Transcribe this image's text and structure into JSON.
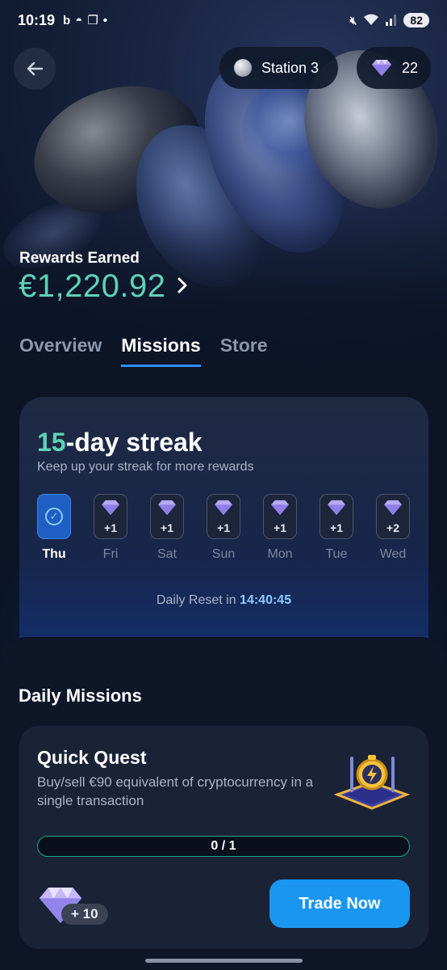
{
  "status_bar": {
    "time": "10:19",
    "battery": "82"
  },
  "header": {
    "station": "Station 3",
    "gems": "22"
  },
  "rewards": {
    "label": "Rewards Earned",
    "amount": "€1,220.92"
  },
  "tabs": [
    {
      "label": "Overview",
      "active": false
    },
    {
      "label": "Missions",
      "active": true
    },
    {
      "label": "Store",
      "active": false
    }
  ],
  "streak": {
    "count": "15",
    "title_suffix": "-day streak",
    "subtitle": "Keep up your streak for more rewards",
    "days": [
      {
        "label": "Thu",
        "bonus": "",
        "done": true
      },
      {
        "label": "Fri",
        "bonus": "+1",
        "done": false
      },
      {
        "label": "Sat",
        "bonus": "+1",
        "done": false
      },
      {
        "label": "Sun",
        "bonus": "+1",
        "done": false
      },
      {
        "label": "Mon",
        "bonus": "+1",
        "done": false
      },
      {
        "label": "Tue",
        "bonus": "+1",
        "done": false
      },
      {
        "label": "Wed",
        "bonus": "+2",
        "done": false
      }
    ],
    "reset_label": "Daily Reset in",
    "reset_time": "14:40:45"
  },
  "daily_missions": {
    "title": "Daily Missions",
    "mission": {
      "title": "Quick Quest",
      "description": "Buy/sell €90 equivalent of cryptocurrency in a single transaction",
      "progress": "0 / 1",
      "reward": "+ 10",
      "button": "Trade Now"
    }
  },
  "colors": {
    "accent_green": "#5fd1b8",
    "accent_blue": "#1a96f0",
    "tab_underline": "#2f8cff"
  }
}
